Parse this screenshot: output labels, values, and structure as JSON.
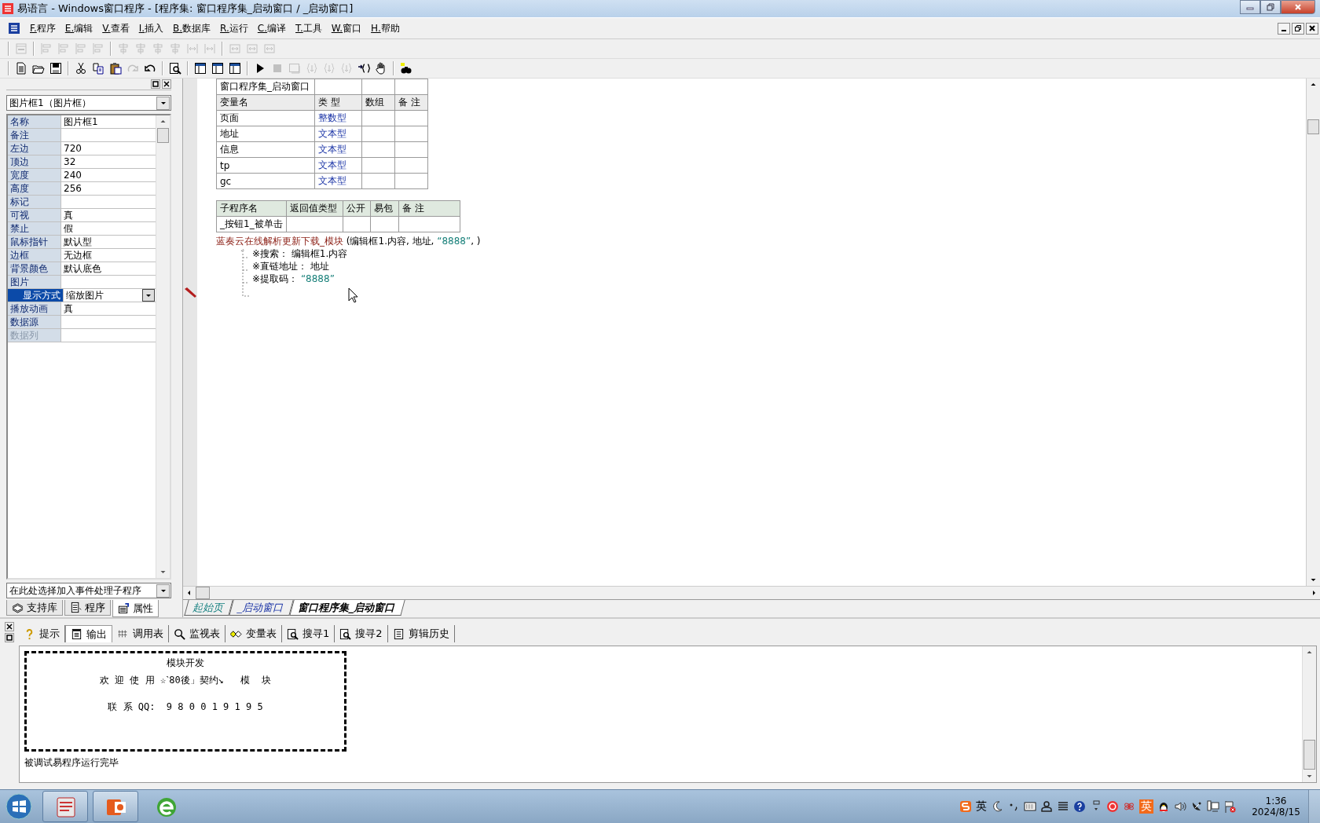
{
  "window": {
    "title": "易语言 - Windows窗口程序 - [程序集: 窗口程序集_启动窗口 / _启动窗口]"
  },
  "menu": [
    "F.程序",
    "E.编辑",
    "V.查看",
    "I.插入",
    "B.数据库",
    "R.运行",
    "C.编译",
    "T.工具",
    "W.窗口",
    "H.帮助"
  ],
  "toolbars": [
    {
      "groups": [
        [
          {
            "kind": "form",
            "disabled": true
          }
        ],
        [
          {
            "kind": "align",
            "disabled": true
          },
          {
            "kind": "align",
            "disabled": true
          },
          {
            "kind": "align",
            "disabled": true
          },
          {
            "kind": "align",
            "disabled": true
          }
        ],
        [
          {
            "kind": "center",
            "disabled": true
          },
          {
            "kind": "center",
            "disabled": true
          },
          {
            "kind": "center",
            "disabled": true
          },
          {
            "kind": "center",
            "disabled": true
          },
          {
            "kind": "spacing",
            "disabled": true
          },
          {
            "kind": "spacing",
            "disabled": true
          }
        ],
        [
          {
            "kind": "size",
            "disabled": true
          },
          {
            "kind": "size",
            "disabled": true
          },
          {
            "kind": "size",
            "disabled": true
          }
        ]
      ]
    },
    {
      "groups": [
        [
          {
            "kind": "new",
            "disabled": false
          },
          {
            "kind": "open",
            "disabled": false
          },
          {
            "kind": "save",
            "disabled": false
          }
        ],
        [
          {
            "kind": "cut",
            "disabled": false
          },
          {
            "kind": "copy",
            "disabled": false
          },
          {
            "kind": "paste",
            "disabled": false
          },
          {
            "kind": "redo",
            "disabled": true
          },
          {
            "kind": "undo",
            "disabled": false
          }
        ],
        [
          {
            "kind": "preview",
            "disabled": false
          }
        ],
        [
          {
            "kind": "layout",
            "disabled": false
          },
          {
            "kind": "layout",
            "disabled": false
          },
          {
            "kind": "layout",
            "disabled": false
          }
        ],
        [
          {
            "kind": "run",
            "disabled": false
          },
          {
            "kind": "stop",
            "disabled": true
          },
          {
            "kind": "window",
            "disabled": true
          },
          {
            "kind": "braces",
            "disabled": true
          },
          {
            "kind": "braces",
            "disabled": true
          },
          {
            "kind": "braces",
            "disabled": true
          },
          {
            "kind": "braces-arrow",
            "disabled": false
          },
          {
            "kind": "hand",
            "disabled": false
          }
        ],
        [
          {
            "kind": "binoculars",
            "disabled": false
          }
        ]
      ]
    }
  ],
  "properties": {
    "object": "图片框1（图片框）",
    "rows": [
      {
        "name": "名称",
        "value": "图片框1",
        "selected": false,
        "disabled": false
      },
      {
        "name": "备注",
        "selected": false,
        "disabled": false
      },
      {
        "name": "左边",
        "value": "720",
        "selected": false,
        "disabled": false
      },
      {
        "name": "顶边",
        "value": "32",
        "selected": false,
        "disabled": false
      },
      {
        "name": "宽度",
        "value": "240",
        "selected": false,
        "disabled": false
      },
      {
        "name": "高度",
        "value": "256",
        "selected": false,
        "disabled": false
      },
      {
        "name": "标记",
        "selected": false,
        "disabled": false
      },
      {
        "name": "可视",
        "value": "真",
        "selected": false,
        "disabled": false
      },
      {
        "name": "禁止",
        "value": "假",
        "selected": false,
        "disabled": false
      },
      {
        "name": "鼠标指针",
        "value": "默认型",
        "selected": false,
        "disabled": false
      },
      {
        "name": "边框",
        "value": "无边框",
        "selected": false,
        "disabled": false
      },
      {
        "name": "背景颜色",
        "value": "默认底色",
        "selected": false,
        "disabled": false
      },
      {
        "name": "图片",
        "selected": false,
        "disabled": false
      },
      {
        "name": "显示方式",
        "value": "缩放图片",
        "selected": true,
        "disabled": false
      },
      {
        "name": "播放动画",
        "value": "真",
        "selected": false,
        "disabled": false
      },
      {
        "name": "数据源",
        "selected": false,
        "disabled": false
      },
      {
        "name": "数据列",
        "selected": false,
        "disabled": true
      }
    ],
    "event_combo": "在此处选择加入事件处理子程序",
    "tabs": [
      {
        "label": "支持库",
        "kind": "library",
        "selected": false
      },
      {
        "label": "程序",
        "kind": "program",
        "selected": false
      },
      {
        "label": "属性",
        "kind": "properties",
        "selected": true
      }
    ]
  },
  "editor": {
    "var_table": {
      "title": "窗口程序集_启动窗口",
      "columns": [
        "变量名",
        "类 型",
        "数组",
        "备 注"
      ],
      "rows": [
        {
          "name": "页面",
          "type": "整数型"
        },
        {
          "name": "地址",
          "type": "文本型"
        },
        {
          "name": "信息",
          "type": "文本型"
        },
        {
          "name": "tp",
          "type": "文本型"
        },
        {
          "name": "gc",
          "type": "文本型"
        }
      ]
    },
    "sub_table": {
      "columns": [
        "子程序名",
        "返回值类型",
        "公开",
        "易包",
        "备 注"
      ],
      "rows": [
        {
          "name": "_按钮1_被单击"
        }
      ]
    },
    "code_line": [
      {
        "kind": "call",
        "text": "蓝奏云在线解析更新下载_模块"
      },
      {
        "kind": "plain",
        "text": " (编辑框1.内容, 地址, "
      },
      {
        "kind": "string",
        "text": "“8888”"
      },
      {
        "kind": "plain",
        "text": ", )"
      }
    ],
    "hints": [
      [
        {
          "kind": "plain",
          "text": "※搜索：  编辑框1.内容"
        }
      ],
      [
        {
          "kind": "plain",
          "text": "※直链地址：  地址"
        }
      ],
      [
        {
          "kind": "plain",
          "text": "※提取码：  "
        },
        {
          "kind": "string",
          "text": "“8888”"
        }
      ]
    ],
    "tabs": [
      {
        "label": "起始页",
        "kind": "start",
        "selected": false
      },
      {
        "label": "_启动窗口",
        "kind": "code",
        "selected": false
      },
      {
        "label": "窗口程序集_启动窗口",
        "kind": "code",
        "selected": true
      }
    ]
  },
  "output": {
    "tabs": [
      {
        "label": "提示",
        "kind": "hint",
        "selected": false
      },
      {
        "label": "输出",
        "kind": "output",
        "selected": true
      },
      {
        "label": "调用表",
        "kind": "calls",
        "selected": false
      },
      {
        "label": "监视表",
        "kind": "watch",
        "selected": false
      },
      {
        "label": "变量表",
        "kind": "vars",
        "selected": false
      },
      {
        "label": "搜寻1",
        "kind": "search",
        "selected": false
      },
      {
        "label": "搜寻2",
        "kind": "search",
        "selected": false
      },
      {
        "label": "剪辑历史",
        "kind": "clip",
        "selected": false
      }
    ],
    "box_lines": [
      "模块开发",
      "欢 迎 使 用 ☆ˋ80後」契约↘   模  块",
      "联 系 QQ:  9 8 0 0 1 9 1 9 5"
    ],
    "status": "被调试易程序运行完毕"
  },
  "taskbar": {
    "apps": [
      {
        "kind": "editor",
        "running": true
      },
      {
        "kind": "office",
        "running": true
      },
      {
        "kind": "browser",
        "running": false
      }
    ],
    "tray": [
      {
        "kind": "ime"
      },
      {
        "kind": "text",
        "text": "英"
      },
      {
        "kind": "moon"
      },
      {
        "kind": "punct"
      },
      {
        "kind": "keyboard"
      },
      {
        "kind": "user"
      },
      {
        "kind": "lines"
      },
      {
        "kind": "help"
      },
      {
        "kind": "arrows"
      },
      {
        "kind": "record"
      },
      {
        "kind": "app"
      },
      {
        "kind": "boxed",
        "text": "英"
      },
      {
        "kind": "penguin"
      },
      {
        "kind": "speaker"
      },
      {
        "kind": "network"
      },
      {
        "kind": "monitor"
      },
      {
        "kind": "flag"
      }
    ],
    "time": "1:36",
    "date": "2024/8/15"
  }
}
